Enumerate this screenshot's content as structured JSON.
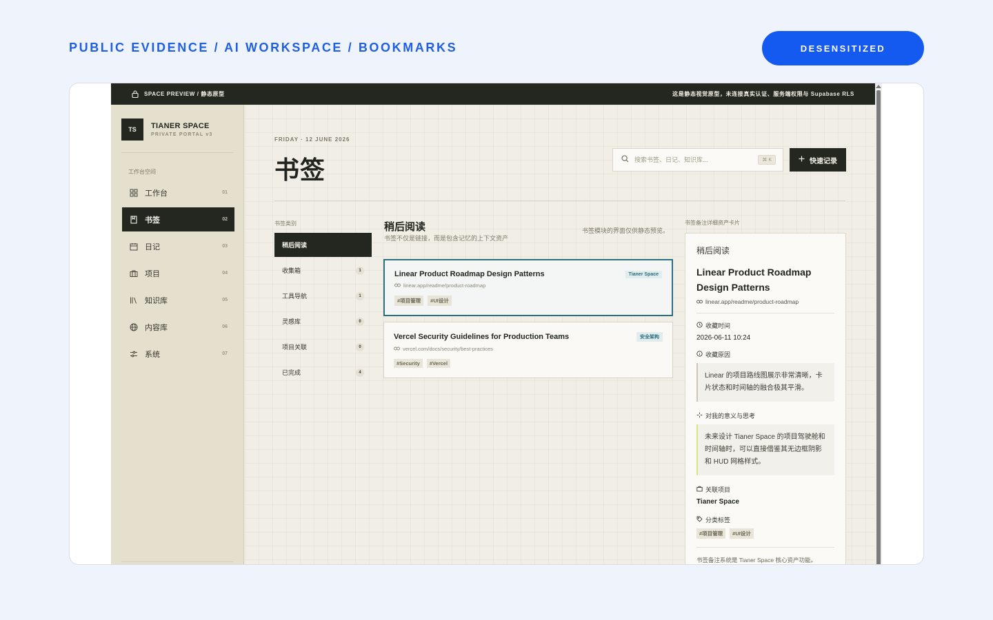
{
  "header": {
    "title": "PUBLIC EVIDENCE / AI WORKSPACE / BOOKMARKS",
    "badge": "DESENSITIZED"
  },
  "topbar": {
    "left": "SPACE PREVIEW / 静态原型",
    "right": "这是静态视觉原型，未连接真实认证、服务端权限与 Supabase RLS",
    "icon": "lock-icon"
  },
  "brand": {
    "logo": "TS",
    "name": "TIANER SPACE",
    "subtitle": "PRIVATE PORTAL v3"
  },
  "sidebar": {
    "section": "工作台空间",
    "items": [
      {
        "label": "工作台",
        "num": "01",
        "icon": "dashboard-icon"
      },
      {
        "label": "书签",
        "num": "02",
        "icon": "bookmark-icon",
        "active": true
      },
      {
        "label": "日记",
        "num": "03",
        "icon": "calendar-icon"
      },
      {
        "label": "项目",
        "num": "04",
        "icon": "briefcase-icon"
      },
      {
        "label": "知识库",
        "num": "05",
        "icon": "library-icon"
      },
      {
        "label": "内容库",
        "num": "06",
        "icon": "globe-icon"
      },
      {
        "label": "系统",
        "num": "07",
        "icon": "settings-icon"
      }
    ]
  },
  "main": {
    "date": "FRIDAY · 12 JUNE 2026",
    "title": "书签",
    "search": {
      "placeholder": "搜索书签、日记、知识库...",
      "shortcut": "⌘ K"
    },
    "quick_button": "快速记录"
  },
  "categories": {
    "title": "书签类别",
    "items": [
      {
        "label": "稍后阅读",
        "count": "",
        "active": true
      },
      {
        "label": "收集箱",
        "count": "1"
      },
      {
        "label": "工具导航",
        "count": "1"
      },
      {
        "label": "灵感库",
        "count": "0"
      },
      {
        "label": "项目关联",
        "count": "0"
      },
      {
        "label": "已完成",
        "count": "4"
      }
    ]
  },
  "list": {
    "title": "稍后阅读",
    "subtitle": "书签不仅是链接，而是包含记忆的上下文资产",
    "note": "书签模块的界面仅供静态预览。",
    "cards": [
      {
        "title": "Linear Product Roadmap Design Patterns",
        "badge": "Tianer Space",
        "url": "linear.app/readme/product-roadmap",
        "tags": [
          "#项目管理",
          "#UI设计"
        ],
        "selected": true
      },
      {
        "title": "Vercel Security Guidelines for Production Teams",
        "badge": "安全架构",
        "url": "vercel.com/docs/security/best-practices",
        "tags": [
          "#Security",
          "#Vercel"
        ]
      }
    ]
  },
  "detail": {
    "heading": "书签备注详细资产卡片",
    "category": "稍后阅读",
    "title": "Linear Product Roadmap Design Patterns",
    "url": "linear.app/readme/product-roadmap",
    "saved_label": "收藏时间",
    "saved_value": "2026-06-11 10:24",
    "reason_label": "收藏原因",
    "reason_text": "Linear 的项目路线图展示非常清晰，卡片状态和时间轴的融合极其平滑。",
    "meaning_label": "对我的意义与思考",
    "meaning_text": "未来设计 Tianer Space 的项目驾驶舱和时间轴时，可以直接借鉴其无边框阴影和 HUD 网格样式。",
    "project_label": "关联项目",
    "project_value": "Tianer Space",
    "tags_label": "分类标签",
    "tags": [
      "#项目管理",
      "#UI设计"
    ],
    "footer": "书签备注系统是 Tianer Space 核心资产功能。"
  },
  "colors": {
    "accent": "#1459f0",
    "dark": "#23271f",
    "sidebar_bg": "#e5dfce",
    "teal": "#2a6e7f"
  }
}
